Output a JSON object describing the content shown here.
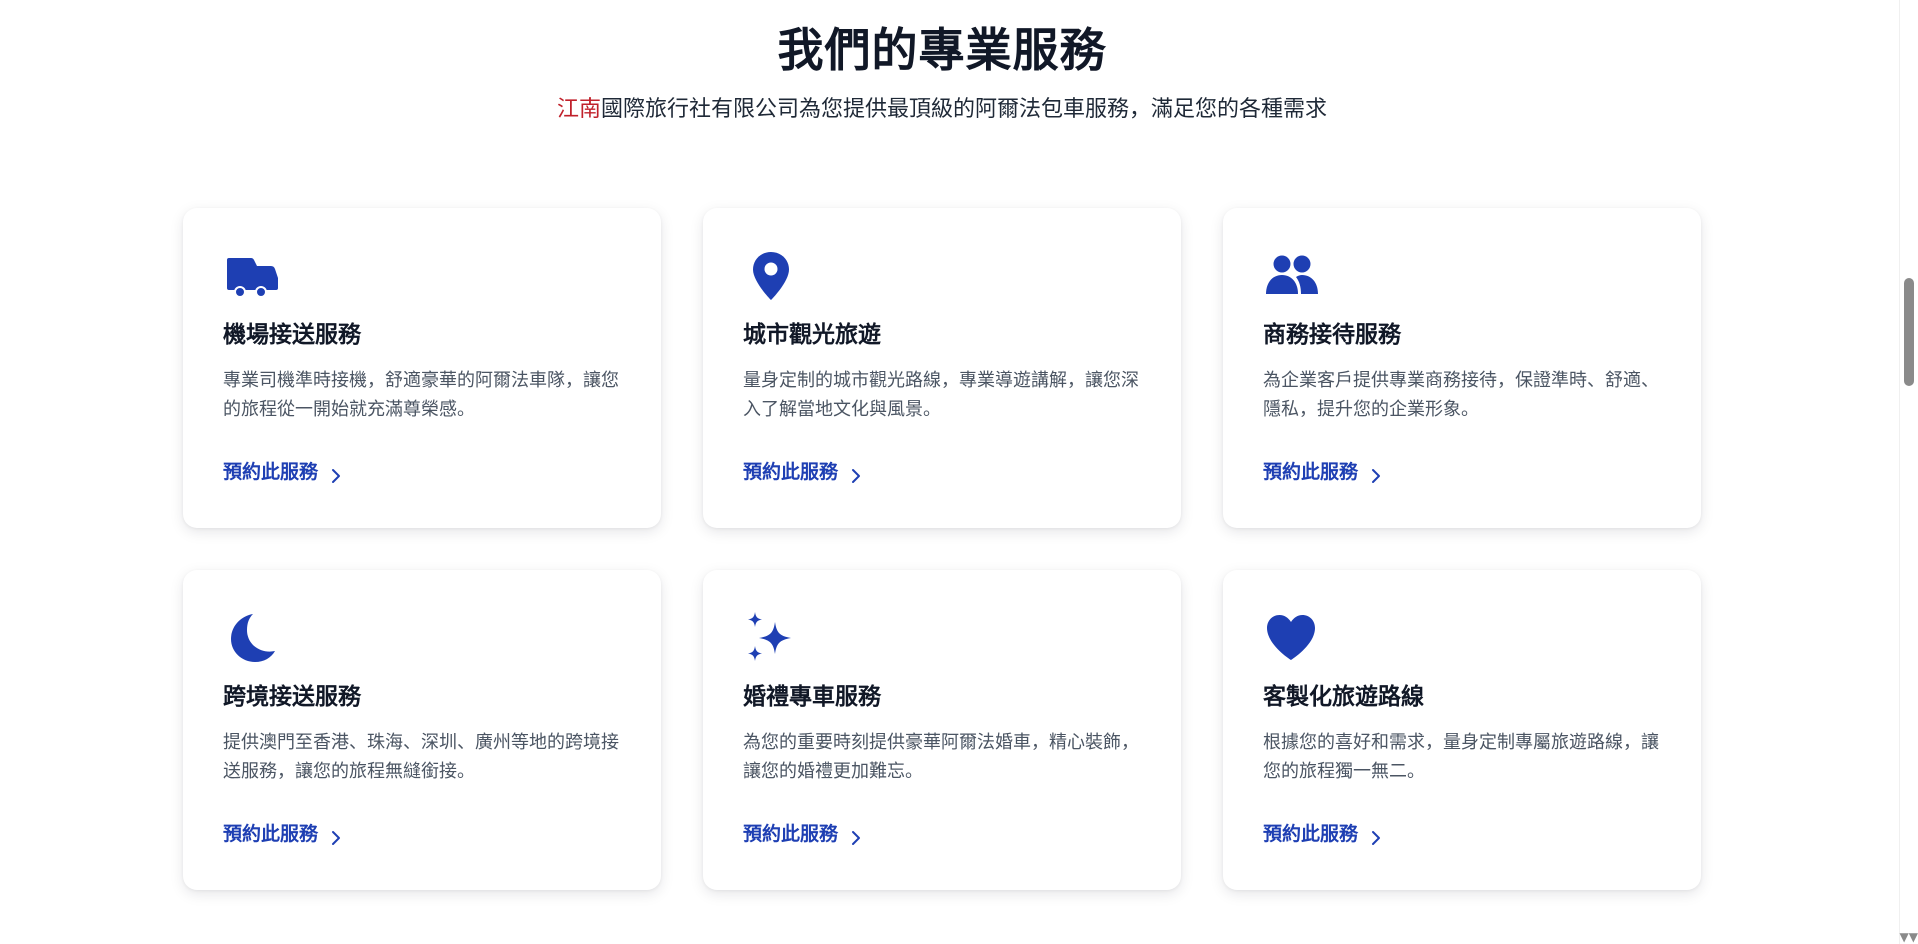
{
  "section": {
    "title": "我們的專業服務",
    "subtitle_brand": "江南",
    "subtitle_rest": "國際旅行社有限公司為您提供最頂級的阿爾法包車服務，滿足您的各種需求"
  },
  "colors": {
    "accent": "#1e3fb3",
    "brand_red": "#c0212b",
    "heading": "#111827",
    "body_text": "#4b5563"
  },
  "services": [
    {
      "icon": "truck-icon",
      "title": "機場接送服務",
      "description": "專業司機準時接機，舒適豪華的阿爾法車隊，讓您的旅程從一開始就充滿尊榮感。",
      "link_label": "預約此服務"
    },
    {
      "icon": "map-pin-icon",
      "title": "城市觀光旅遊",
      "description": "量身定制的城市觀光路線，專業導遊講解，讓您深入了解當地文化與風景。",
      "link_label": "預約此服務"
    },
    {
      "icon": "users-icon",
      "title": "商務接待服務",
      "description": "為企業客戶提供專業商務接待，保證準時、舒適、隱私，提升您的企業形象。",
      "link_label": "預約此服務"
    },
    {
      "icon": "moon-icon",
      "title": "跨境接送服務",
      "description": "提供澳門至香港、珠海、深圳、廣州等地的跨境接送服務，讓您的旅程無縫銜接。",
      "link_label": "預約此服務"
    },
    {
      "icon": "sparkles-icon",
      "title": "婚禮專車服務",
      "description": "為您的重要時刻提供豪華阿爾法婚車，精心裝飾，讓您的婚禮更加難忘。",
      "link_label": "預約此服務"
    },
    {
      "icon": "heart-icon",
      "title": "客製化旅遊路線",
      "description": "根據您的喜好和需求，量身定制專屬旅遊路線，讓您的旅程獨一無二。",
      "link_label": "預約此服務"
    }
  ]
}
